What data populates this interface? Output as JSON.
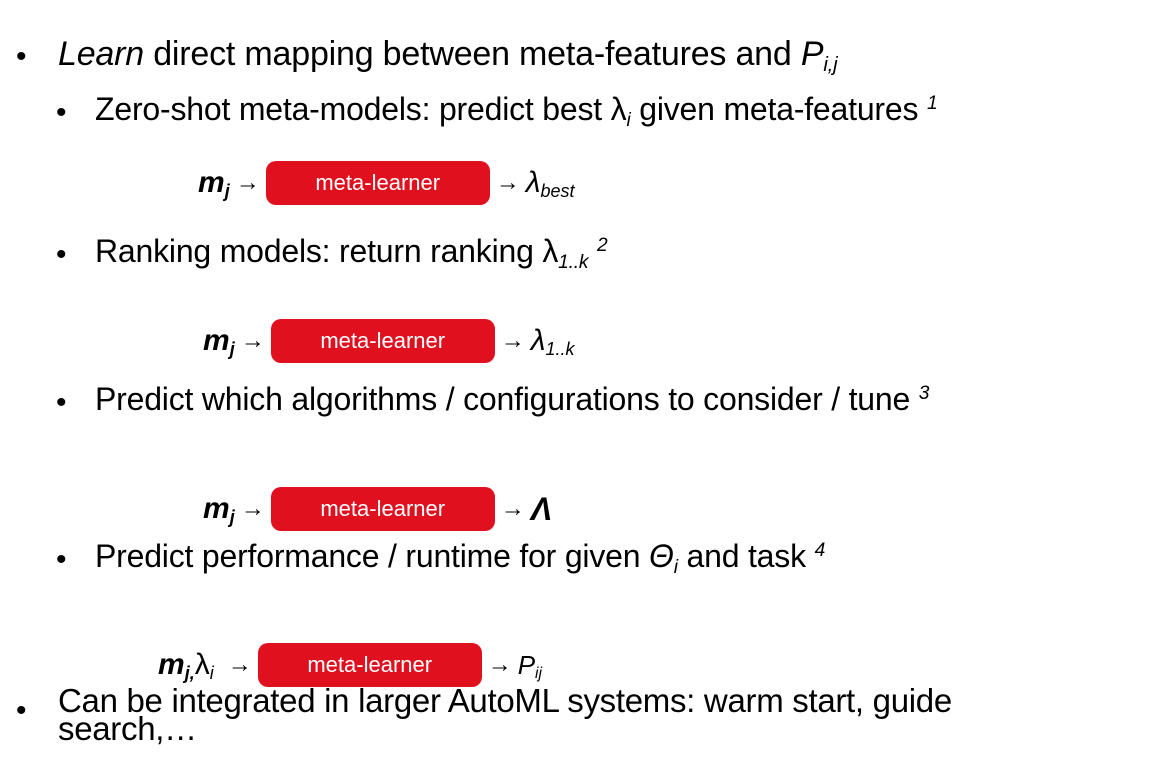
{
  "slide": {
    "b1": {
      "word_italic": "Learn",
      "text": " direct mapping between meta-features and ",
      "var": "P",
      "sub": "i,j"
    },
    "s1": {
      "text": "Zero-shot meta-models: predict best λ",
      "sub": "i",
      "text2": " given meta-features ",
      "sup": "1"
    },
    "d1": {
      "input": "m",
      "input_sub": "j",
      "arrow_in": "→",
      "box": "meta-learner",
      "arrow_out": "→",
      "output": "λ",
      "output_sub": "best"
    },
    "s2": {
      "text": "Ranking models: return ranking λ",
      "sub": "1..k",
      "sup": "2"
    },
    "d2": {
      "input": "m",
      "input_sub": "j",
      "arrow_in": "→",
      "box": "meta-learner",
      "arrow_out": "→",
      "output": "λ",
      "output_sub": "1..k"
    },
    "s3": {
      "text": "Predict which algorithms / configurations to consider / tune ",
      "sup": "3"
    },
    "d3": {
      "input": "m",
      "input_sub": "j",
      "arrow_in": "→",
      "box": "meta-learner",
      "arrow_out": "→",
      "output": "Λ"
    },
    "s4": {
      "text": "Predict performance / runtime for given ",
      "var": "Θ",
      "sub": "i",
      "text2": " and task ",
      "sup": "4"
    },
    "d4": {
      "input": "m",
      "input_sub": "j,",
      "input2": " λ",
      "input2_sub": "i",
      "arrow_in": "→",
      "box": "meta-learner",
      "arrow_out": "→",
      "output": "P",
      "output_sub": "ij"
    },
    "b2": {
      "line1": "Can be integrated in larger AutoML systems: warm start, guide",
      "line2": "search,…"
    },
    "bullet": "•"
  }
}
